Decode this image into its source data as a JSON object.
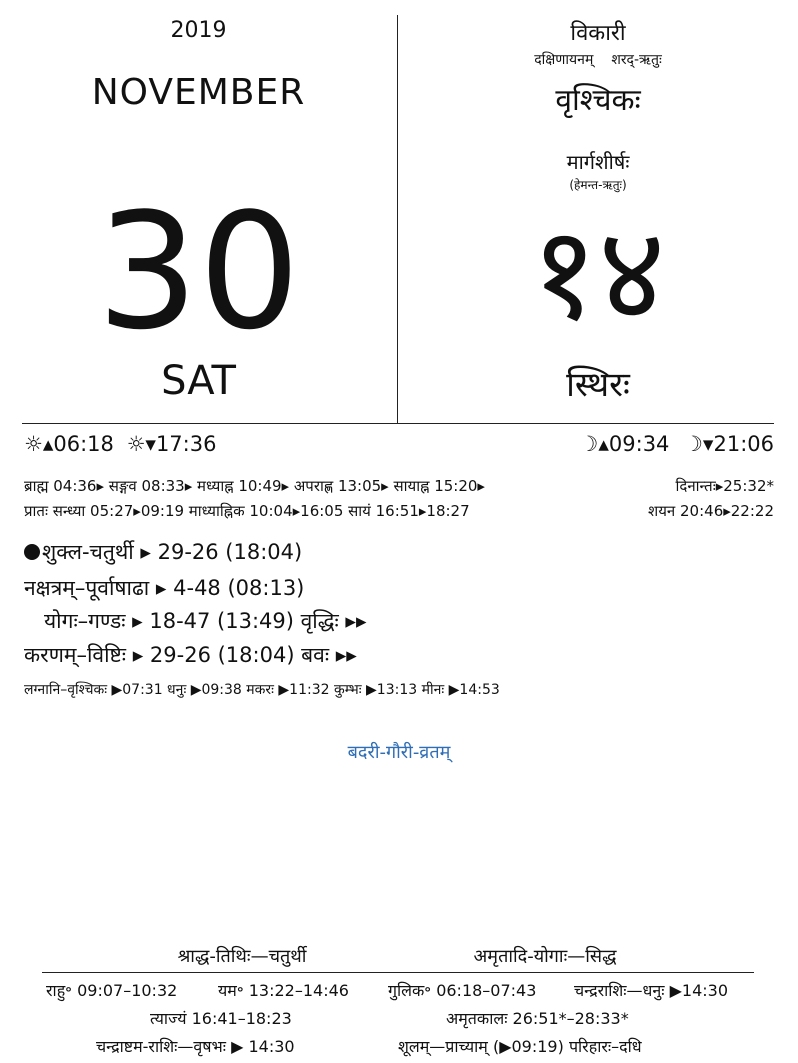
{
  "left": {
    "year": "2019",
    "month": "NOVEMBER",
    "date": "30",
    "weekday": "SAT"
  },
  "right": {
    "samvatsara": "विकारी",
    "ayana": "दक्षिणायनम्",
    "ritu": "शरद्-ऋतुः",
    "rashi": "वृश्चिकः",
    "masa": "मार्गशीर्षः",
    "masa_ritu": "(हेमन्त-ऋतुः)",
    "tithi_number": "१४",
    "tithi_name": "स्थिरः"
  },
  "sun_moon": {
    "sunrise": "☼▴06:18",
    "sunset": "☼▾17:36",
    "moonrise": "☽▴09:34",
    "moonset": "☽▾21:06"
  },
  "kala_line1": "ब्राह्म 04:36▸ सङ्गव 08:33▸ मध्याह्न 10:49▸ अपराह्ण 13:05▸ सायाह्न 15:20▸",
  "dinanta": "दिनान्तः▸25:32*",
  "kala_line2": "प्रातः सन्ध्या 05:27▸09:19 माध्याह्निक 10:04▸16:05 सायं 16:51▸18:27",
  "shayana": "शयन 20:46▸22:22",
  "tithi_line": "शुक्ल-चतुर्थी ▸ 29-26 (18:04)",
  "nakshatra_line": "नक्षत्रम्–पूर्वाषाढा ▸ 4-48 (08:13)",
  "yoga_line": "योगः–गण्डः ▸ 18-47 (13:49)  वृद्धिः ▸▸",
  "karana_line": "करणम्–विष्टिः ▸ 29-26 (18:04)  बवः ▸▸",
  "lagna_line": "लग्नानि–वृश्चिकः ▶07:31 धनुः ▶09:38 मकरः ▶11:32 कुम्भः ▶13:13 मीनः ▶14:53",
  "festival": "बदरी-गौरी-व्रतम्",
  "footer": {
    "shraddha": "श्राद्ध-तिथिः—चतुर्थी",
    "amritadi": "अमृतादि-योगाः—सिद्ध",
    "rahu": "राहु॰ 09:07–10:32",
    "yama": "यम॰ 13:22–14:46",
    "gulika": "गुलिक॰ 06:18–07:43",
    "chandrarashi": "चन्द्रराशिः—धनुः ▶14:30",
    "tyajya": "त्याज्यं 16:41–18:23",
    "amritakala": "अमृतकालः 26:51*–28:33*",
    "chandrashtama": "चन्द्राष्टम-राशिः—वृषभः ▶ 14:30",
    "shula": "शूलम्—प्राच्याम् (▶09:19) परिहारः–दधि"
  },
  "colors": {
    "festival": "#2f6db5"
  }
}
